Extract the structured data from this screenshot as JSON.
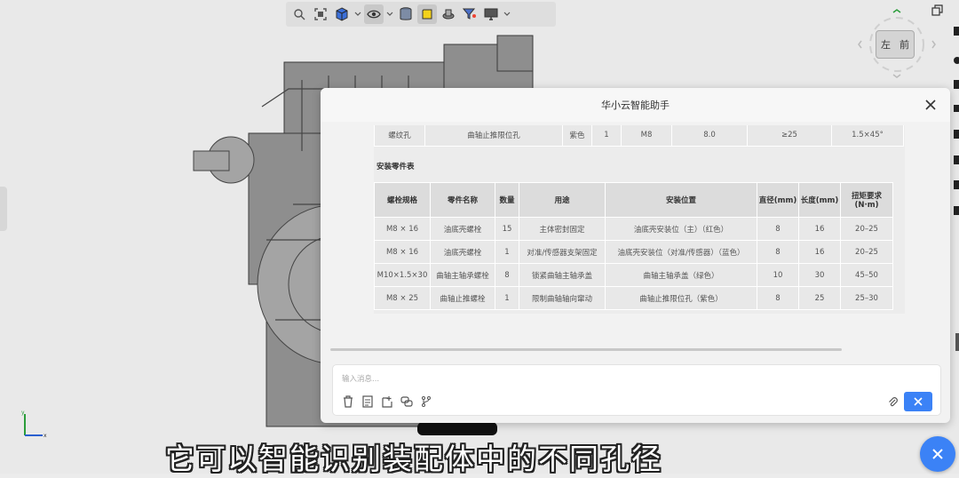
{
  "dialog": {
    "title": "华小云智能助手"
  },
  "hole_table": {
    "row": [
      "螺纹孔",
      "曲轴止推限位孔",
      "紫色",
      "1",
      "M8",
      "8.0",
      "≥25",
      "1.5×45°"
    ]
  },
  "section_title": "安装零件表",
  "parts_table": {
    "headers": [
      "螺栓规格",
      "零件名称",
      "数量",
      "用途",
      "安装位置",
      "直径(mm)",
      "长度(mm)",
      "扭矩要求(N·m)"
    ],
    "rows": [
      [
        "M8 × 16",
        "油底壳螺栓",
        "15",
        "主体密封固定",
        "油底壳安装位（主）（红色）",
        "8",
        "16",
        "20–25"
      ],
      [
        "M8 × 16",
        "油底壳螺栓",
        "1",
        "对准/传感器支架固定",
        "油底壳安装位（对准/传感器）（蓝色）",
        "8",
        "16",
        "20–25"
      ],
      [
        "M10×1.5×30",
        "曲轴主轴承螺栓",
        "8",
        "锁紧曲轴主轴承盖",
        "曲轴主轴承盖（绿色）",
        "10",
        "30",
        "45–50"
      ],
      [
        "M8 × 25",
        "曲轴止推螺栓",
        "1",
        "限制曲轴轴向窜动",
        "曲轴止推限位孔（紫色）",
        "8",
        "25",
        "25–30"
      ]
    ]
  },
  "input": {
    "placeholder": "输入消息..."
  },
  "navcube": {
    "left_label": "左",
    "front_label": "前"
  },
  "caption": "它可以智能识别装配体中的不同孔径",
  "colors": {
    "accent": "#3b82f6"
  }
}
